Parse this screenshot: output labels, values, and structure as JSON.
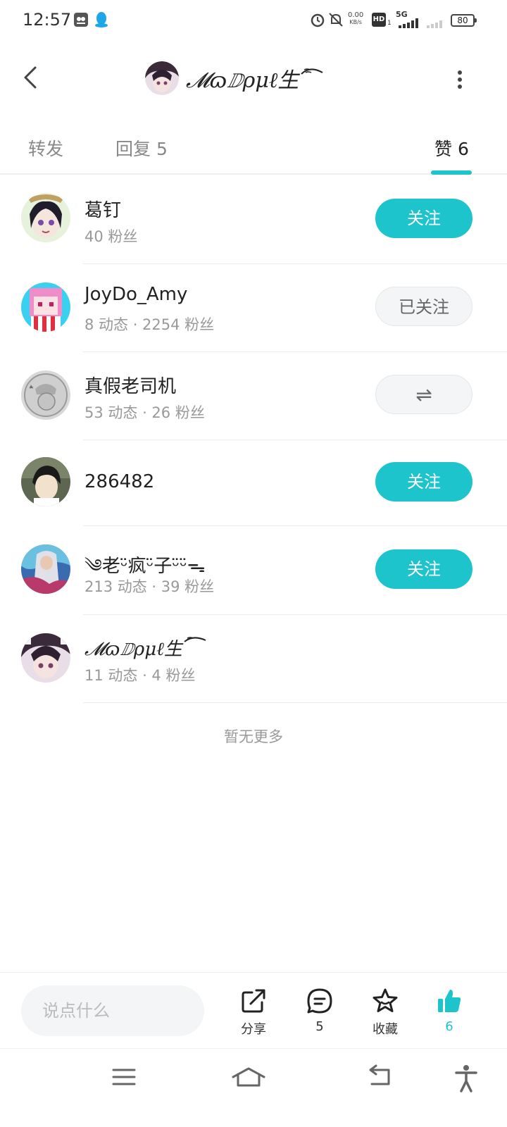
{
  "status_bar": {
    "time": "12:57",
    "net_speed_value": "0.00",
    "net_speed_unit": "KB/s",
    "hd_label": "HD",
    "hd_sub": "1",
    "network": "5G",
    "battery": "80"
  },
  "header": {
    "title": "𝓜ɷⅅρμℓ生"
  },
  "tabs": [
    {
      "label": "转发",
      "active": false
    },
    {
      "label": "回复 5",
      "active": false
    },
    {
      "label": "赞 6",
      "active": true
    }
  ],
  "users": [
    {
      "name": "葛钉",
      "meta": "40 粉丝",
      "button": "关注",
      "button_type": "follow"
    },
    {
      "name": "JoyDo_Amy",
      "meta": "8 动态 · 2254 粉丝",
      "button": "已关注",
      "button_type": "followed"
    },
    {
      "name": "真假老司机",
      "meta": "53 动态 · 26 粉丝",
      "button": "⇌",
      "button_type": "mutual"
    },
    {
      "name": "286482",
      "meta": "",
      "button": "关注",
      "button_type": "follow"
    },
    {
      "name": "༄老ᵕ̈疯ᵕ̈子ᵕ̈ᵕ̈ᯓ",
      "meta": "213 动态 · 39 粉丝",
      "button": "关注",
      "button_type": "follow"
    },
    {
      "name": "𝓜ɷⅅρμℓ生",
      "meta": "11 动态 · 4 粉丝",
      "button": "",
      "button_type": "none"
    }
  ],
  "no_more": "暂无更多",
  "action_bar": {
    "input_placeholder": "说点什么",
    "share_label": "分享",
    "comment_count": "5",
    "favorite_label": "收藏",
    "like_count": "6"
  },
  "colors": {
    "accent": "#1ec4cc"
  }
}
